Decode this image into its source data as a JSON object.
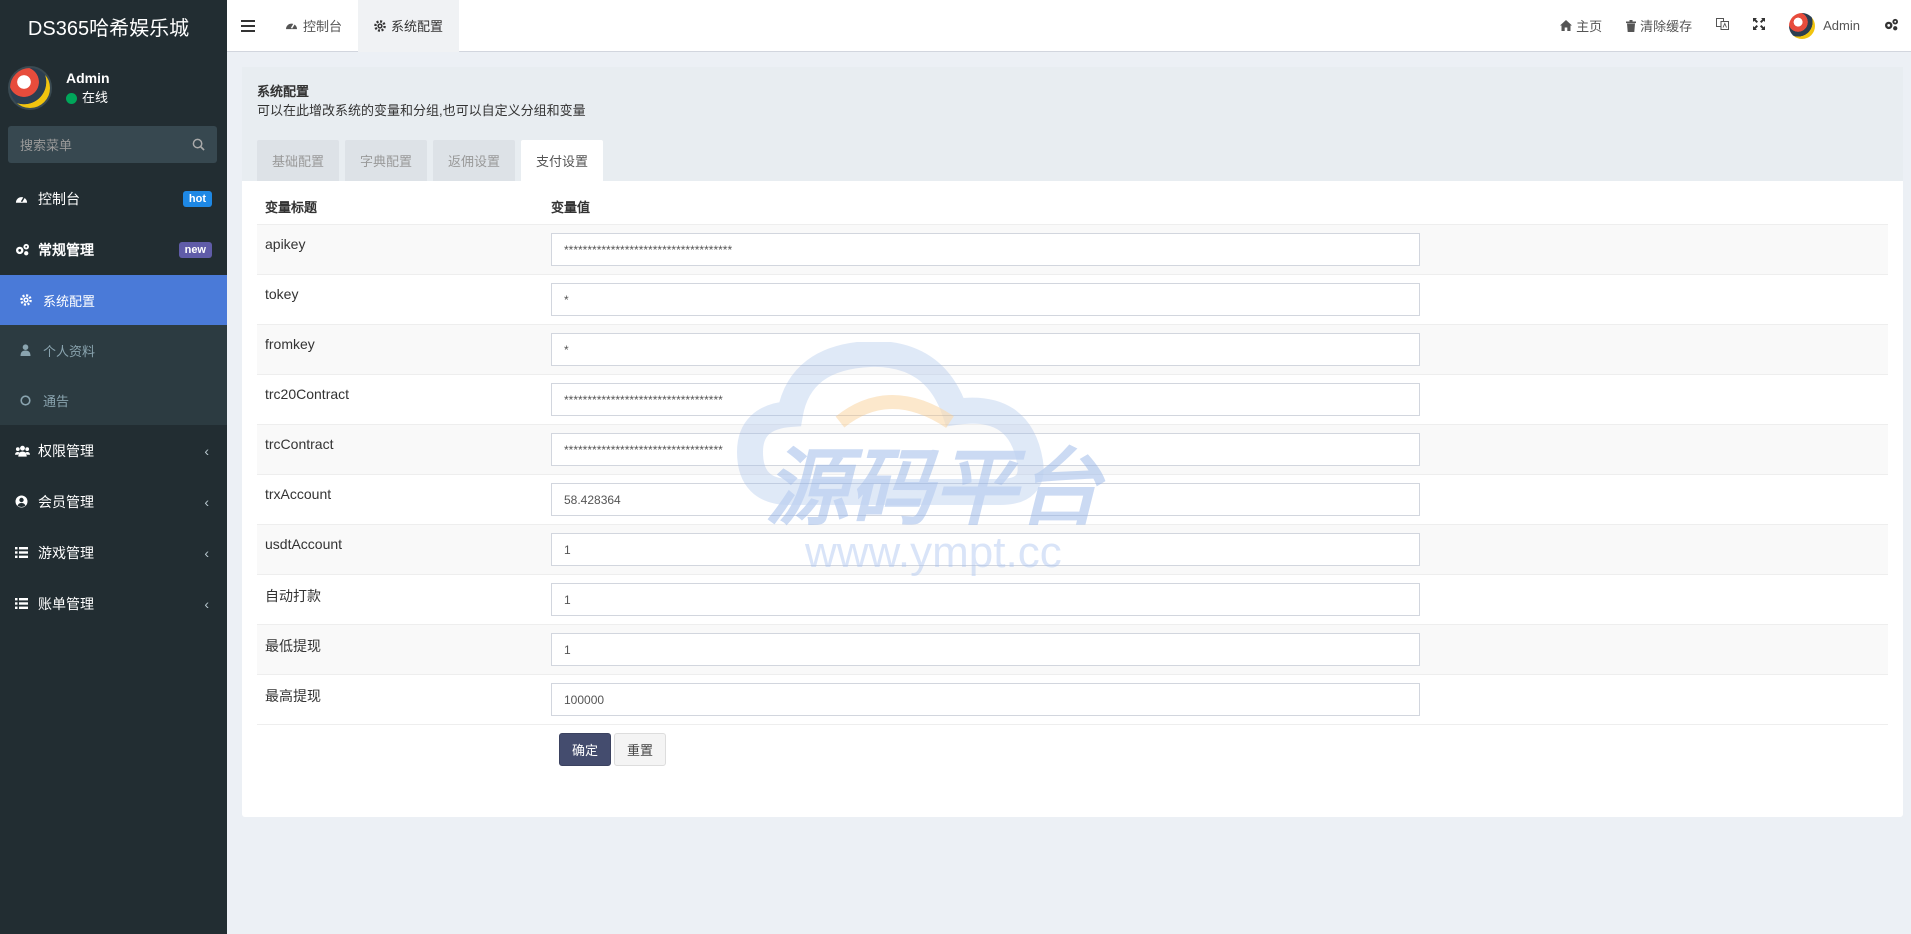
{
  "sidebar": {
    "brand": "DS365哈希娱乐城",
    "user_name": "Admin",
    "user_status": "在线",
    "search_placeholder": "搜索菜单",
    "items": [
      {
        "label": "控制台",
        "badge": "hot",
        "icon": "dashboard-icon"
      },
      {
        "label": "常规管理",
        "badge": "new",
        "icon": "cogs-icon"
      },
      {
        "label": "系统配置",
        "icon": "gear-icon"
      },
      {
        "label": "个人资料",
        "icon": "user-icon"
      },
      {
        "label": "通告",
        "icon": "circle-icon"
      },
      {
        "label": "权限管理",
        "icon": "group-icon"
      },
      {
        "label": "会员管理",
        "icon": "user-circle-icon"
      },
      {
        "label": "游戏管理",
        "icon": "list-icon"
      },
      {
        "label": "账单管理",
        "icon": "list-icon"
      }
    ]
  },
  "topbar": {
    "tabs": [
      {
        "label": "控制台",
        "icon": "dashboard-icon"
      },
      {
        "label": "系统配置",
        "icon": "gear-icon"
      }
    ],
    "home": "主页",
    "clear_cache": "清除缓存",
    "user": "Admin"
  },
  "panel": {
    "title": "系统配置",
    "description": "可以在此增改系统的变量和分组,也可以自定义分组和变量",
    "tabs": [
      "基础配置",
      "字典配置",
      "返佣设置",
      "支付设置"
    ],
    "active_tab": "支付设置"
  },
  "table": {
    "col_title": "变量标题",
    "col_value": "变量值",
    "rows": [
      {
        "label": "apikey",
        "value": "************************************"
      },
      {
        "label": "tokey",
        "value": "*"
      },
      {
        "label": "fromkey",
        "value": "*"
      },
      {
        "label": "trc20Contract",
        "value": "**********************************"
      },
      {
        "label": "trcContract",
        "value": "**********************************"
      },
      {
        "label": "trxAccount",
        "value": "58.428364"
      },
      {
        "label": "usdtAccount",
        "value": "1"
      },
      {
        "label": "自动打款",
        "value": "1"
      },
      {
        "label": "最低提现",
        "value": "1"
      },
      {
        "label": "最高提现",
        "value": "100000"
      }
    ]
  },
  "buttons": {
    "confirm": "确定",
    "reset": "重置"
  },
  "watermark": {
    "title": "源码平台",
    "url": "www.ympt.cc"
  }
}
